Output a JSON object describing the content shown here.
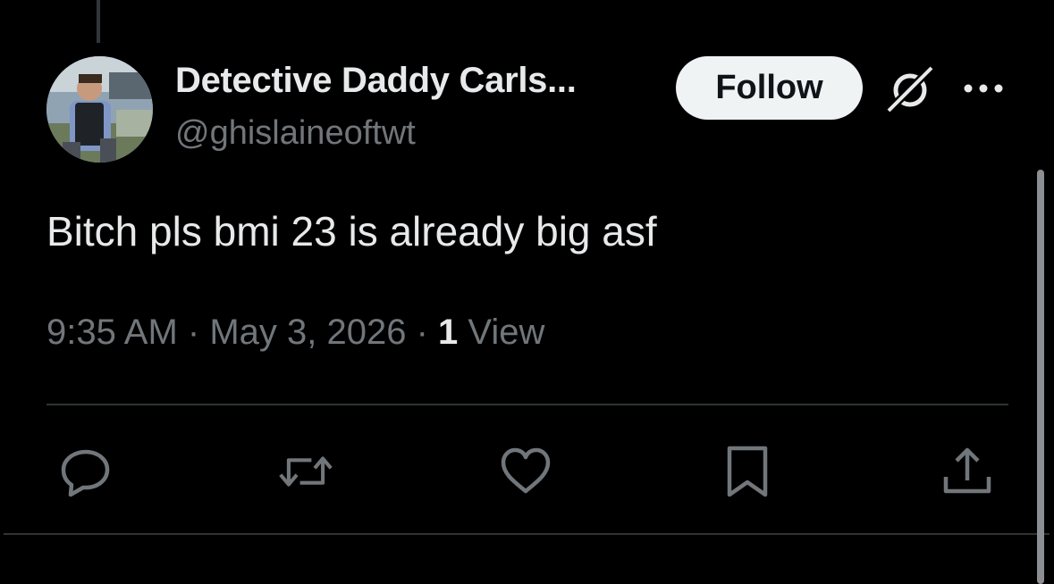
{
  "author": {
    "display_name": "Detective Daddy Carls...",
    "handle": "@ghislaineoftwt"
  },
  "header": {
    "follow_label": "Follow",
    "grok_icon": "grok-icon",
    "more_icon": "more-horizontal-icon"
  },
  "tweet": {
    "text": "Bitch pls bmi 23 is already big asf",
    "time": "9:35 AM",
    "separator1": " · ",
    "date": "May 3, 2026",
    "separator2": " · ",
    "view_count": "1",
    "view_label": " View"
  },
  "actions": [
    {
      "name": "reply",
      "icon": "reply-icon"
    },
    {
      "name": "retweet",
      "icon": "retweet-icon"
    },
    {
      "name": "like",
      "icon": "heart-icon"
    },
    {
      "name": "bookmark",
      "icon": "bookmark-icon"
    },
    {
      "name": "share",
      "icon": "share-icon"
    }
  ],
  "colors": {
    "background": "#000000",
    "text_primary": "#e7e9ea",
    "text_secondary": "#71767b",
    "divider": "#2f3336",
    "follow_bg": "#eff3f4"
  }
}
